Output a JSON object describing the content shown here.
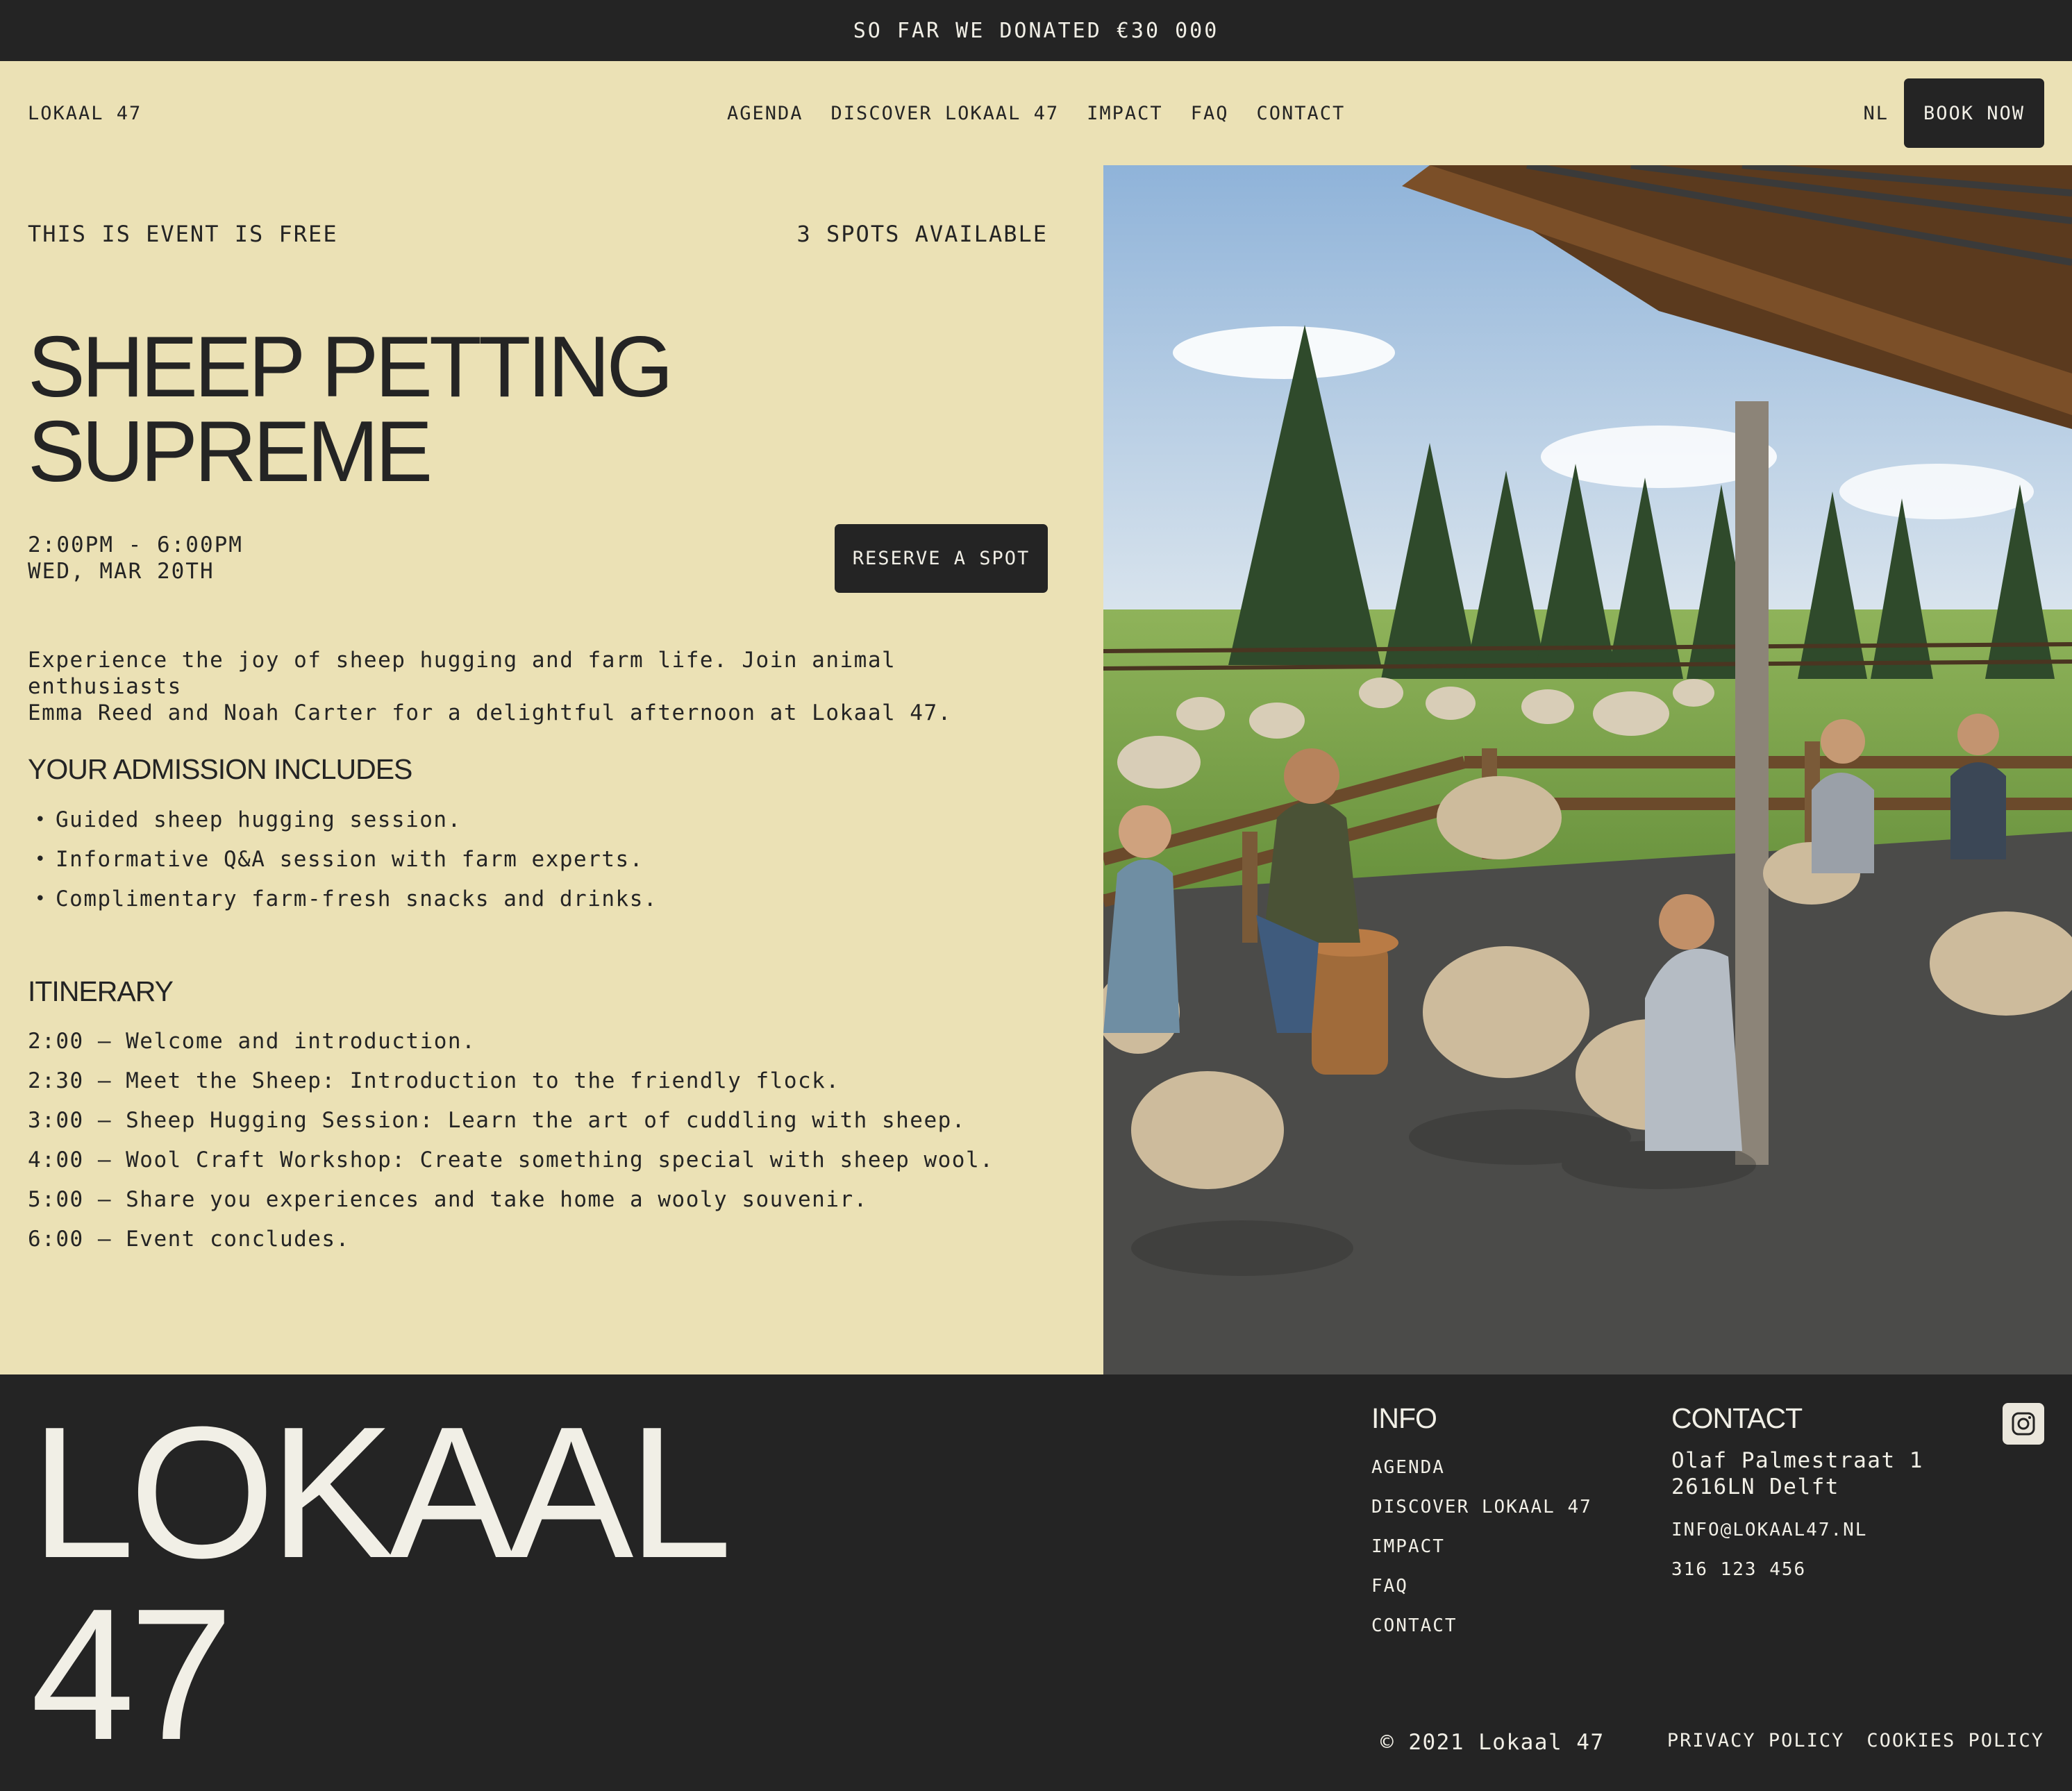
{
  "announcement": "SO FAR WE DONATED €30 000",
  "nav": {
    "brand": "LOKAAL 47",
    "links": [
      "AGENDA",
      "DISCOVER LOKAAL 47",
      "IMPACT",
      "FAQ",
      "CONTACT"
    ],
    "language": "NL",
    "book_label": "BOOK NOW"
  },
  "event": {
    "price_note": "THIS IS EVENT IS FREE",
    "spots": "3 SPOTS AVAILABLE",
    "title_line1": "SHEEP PETTING",
    "title_line2": "SUPREME",
    "time": "2:00PM - 6:00PM",
    "date": "WED, MAR 20TH",
    "reserve_label": "RESERVE A SPOT",
    "description_line1": "Experience the joy of sheep hugging and farm life. Join animal enthusiasts",
    "description_line2": "Emma Reed and Noah Carter for a delightful afternoon at Lokaal 47.",
    "admission_heading": "YOUR ADMISSION INCLUDES",
    "admission_items": [
      "Guided sheep hugging session.",
      "Informative Q&A session with farm experts.",
      "Complimentary farm-fresh snacks and drinks."
    ],
    "itinerary_heading": "ITINERARY",
    "itinerary": [
      "2:00 — Welcome and introduction.",
      "2:30 — Meet the Sheep: Introduction to the friendly flock.",
      "3:00 — Sheep Hugging Session: Learn the art of cuddling with sheep.",
      "4:00 — Wool Craft Workshop: Create something special with sheep wool.",
      "5:00 — Share you experiences and take home a wooly souvenir.",
      "6:00 — Event concludes."
    ]
  },
  "footer": {
    "logo_line1": "LOKAAL",
    "logo_line2": "47",
    "info_heading": "INFO",
    "info_links": [
      "AGENDA",
      "DISCOVER LOKAAL 47",
      "IMPACT",
      "FAQ",
      "CONTACT"
    ],
    "contact_heading": "CONTACT",
    "address_line1": "Olaf Palmestraat 1",
    "address_line2": "2616LN Delft",
    "email": "INFO@LOKAAL47.NL",
    "phone": "316 123 456",
    "social_icon": "instagram-icon",
    "copyright": "© 2021 Lokaal 47",
    "privacy": "PRIVACY POLICY",
    "cookies": "COOKIES POLICY"
  },
  "colors": {
    "background": "#ebe1b5",
    "dark": "#242424",
    "light_text": "#f1efe6"
  }
}
